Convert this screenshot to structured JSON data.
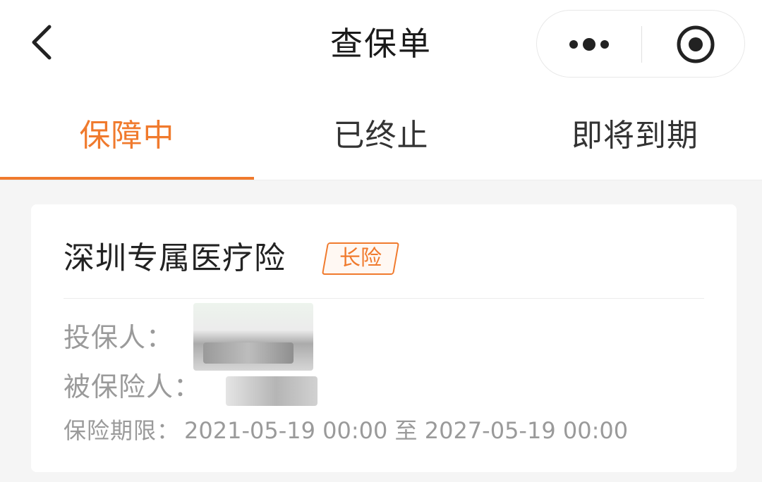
{
  "header": {
    "title": "查保单",
    "back_icon": "chevron-left-icon",
    "more_icon": "more-dots-icon",
    "close_icon": "target-close-icon"
  },
  "tabs": [
    {
      "label": "保障中",
      "active": true
    },
    {
      "label": "已终止",
      "active": false
    },
    {
      "label": "即将到期",
      "active": false
    }
  ],
  "policy": {
    "product_name": "深圳专属医疗险",
    "tag": "长险",
    "policy_holder_label": "投保人：",
    "insured_label": "被保险人：",
    "period_label": "保险期限：",
    "period_value": "2021-05-19 00:00 至 2027-05-19 00:00"
  },
  "colors": {
    "accent": "#f07a2d",
    "background": "#f5f5f5",
    "card": "#ffffff",
    "muted_text": "#9a9a9a"
  }
}
